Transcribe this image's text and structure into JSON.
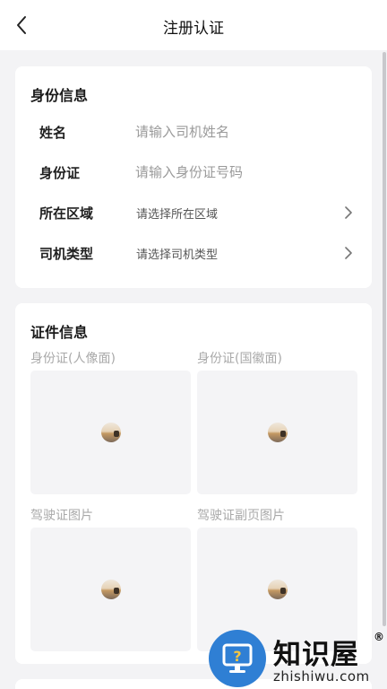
{
  "header": {
    "title": "注册认证"
  },
  "personal": {
    "title": "身份信息",
    "name": {
      "label": "姓名",
      "placeholder": "请输入司机姓名",
      "value": ""
    },
    "id_card": {
      "label": "身份证",
      "placeholder": "请输入身份证号码",
      "value": ""
    },
    "region": {
      "label": "所在区域",
      "value": "请选择所在区域"
    },
    "driver_type": {
      "label": "司机类型",
      "value": "请选择司机类型"
    }
  },
  "documents": {
    "title": "证件信息",
    "uploads": [
      {
        "label": "身份证(人像面)"
      },
      {
        "label": "身份证(国徽面)"
      },
      {
        "label": "驾驶证图片"
      },
      {
        "label": "驾驶证副页图片"
      }
    ]
  },
  "watermark": {
    "name": "知识屋",
    "reg": "®",
    "url": "zhishiwu.com"
  },
  "colors": {
    "background": "#f3f3f5",
    "card": "#ffffff",
    "placeholder": "#9a9a9a",
    "upload_box": "#f4f4f6",
    "watermark_blue": "#2f7fd4"
  }
}
